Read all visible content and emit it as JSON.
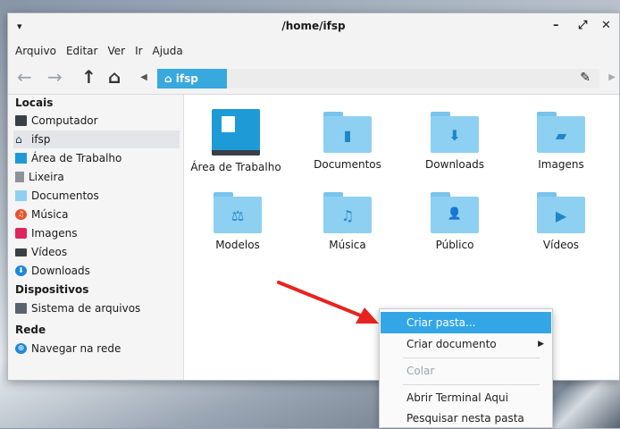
{
  "window": {
    "title": "/home/ifsp",
    "menu_glyph": "▾",
    "minimize_glyph": "–",
    "maximize_glyph": "⤢",
    "close_glyph": "✕"
  },
  "menubar": [
    "Arquivo",
    "Editar",
    "Ver",
    "Ir",
    "Ajuda"
  ],
  "toolbar": {
    "back_glyph": "←",
    "forward_glyph": "→",
    "up_glyph": "↑",
    "home_glyph": "⌂",
    "crumb_left_glyph": "◀",
    "crumb_right_glyph": "▶",
    "current_crumb": "ifsp",
    "edit_glyph": "✎"
  },
  "sidebar": {
    "sections": [
      {
        "title": "Locais",
        "items": [
          "Computador",
          "ifsp",
          "Área de Trabalho",
          "Lixeira",
          "Documentos",
          "Música",
          "Imagens",
          "Vídeos",
          "Downloads"
        ]
      },
      {
        "title": "Dispositivos",
        "items": [
          "Sistema de arquivos"
        ]
      },
      {
        "title": "Rede",
        "items": [
          "Navegar na rede"
        ]
      }
    ]
  },
  "folders": [
    {
      "name": "Área de Trabalho",
      "icon": "desktop-folder-icon"
    },
    {
      "name": "Documentos",
      "icon": "documents-folder-icon",
      "glyph": "▮"
    },
    {
      "name": "Downloads",
      "icon": "downloads-folder-icon",
      "glyph": "⬇"
    },
    {
      "name": "Imagens",
      "icon": "pictures-folder-icon",
      "glyph": "▰"
    },
    {
      "name": "Modelos",
      "icon": "templates-folder-icon",
      "glyph": "⚖"
    },
    {
      "name": "Música",
      "icon": "music-folder-icon",
      "glyph": "♫"
    },
    {
      "name": "Público",
      "icon": "public-folder-icon",
      "glyph": "👤"
    },
    {
      "name": "Vídeos",
      "icon": "videos-folder-icon",
      "glyph": "▶"
    }
  ],
  "context_menu": {
    "items": [
      {
        "label": "Criar pasta...",
        "state": "highlighted"
      },
      {
        "label": "Criar documento",
        "state": "normal",
        "submenu_glyph": "▶"
      },
      {
        "label": "Colar",
        "state": "disabled"
      },
      {
        "label": "Abrir Terminal Aqui",
        "state": "normal"
      },
      {
        "label": "Pesquisar nesta pasta",
        "state": "normal"
      }
    ]
  },
  "colors": {
    "accent": "#37a9de",
    "menu_highlight": "#33a6e6",
    "folder": "#8ed0f2",
    "annotation_arrow": "#e8231f"
  }
}
